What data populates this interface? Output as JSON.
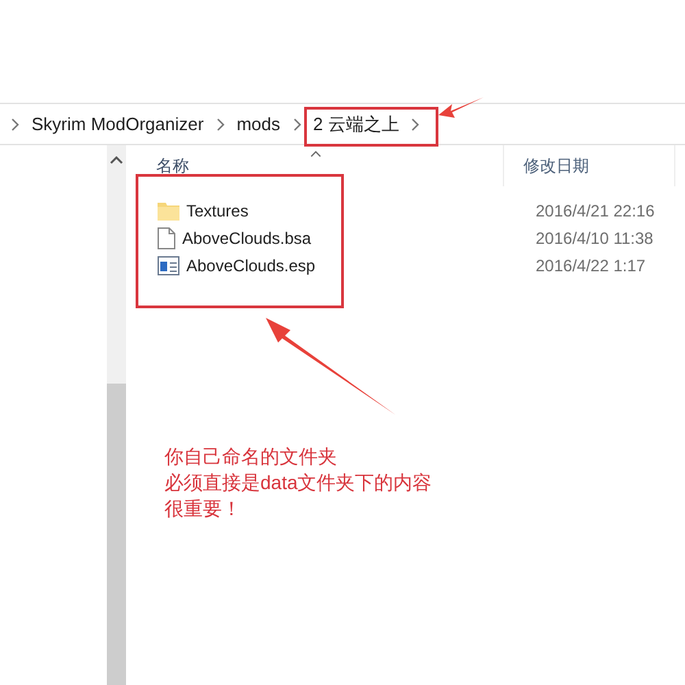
{
  "breadcrumb": [
    {
      "label": "Skyrim ModOrganizer"
    },
    {
      "label": "mods"
    },
    {
      "label": "2 云端之上"
    }
  ],
  "columns": [
    {
      "label": "名称",
      "sorted": true
    },
    {
      "label": "修改日期",
      "sorted": false
    }
  ],
  "files": [
    {
      "name": "Textures",
      "kind": "folder",
      "modified": "2016/4/21 22:16"
    },
    {
      "name": "AboveClouds.bsa",
      "kind": "file",
      "modified": "2016/4/10 11:38"
    },
    {
      "name": "AboveClouds.esp",
      "kind": "plugin",
      "modified": "2016/4/22 1:17"
    }
  ],
  "annotation": {
    "lines": [
      "你自己命名的文件夹",
      "必须直接是data文件夹下的内容",
      "很重要！"
    ]
  }
}
